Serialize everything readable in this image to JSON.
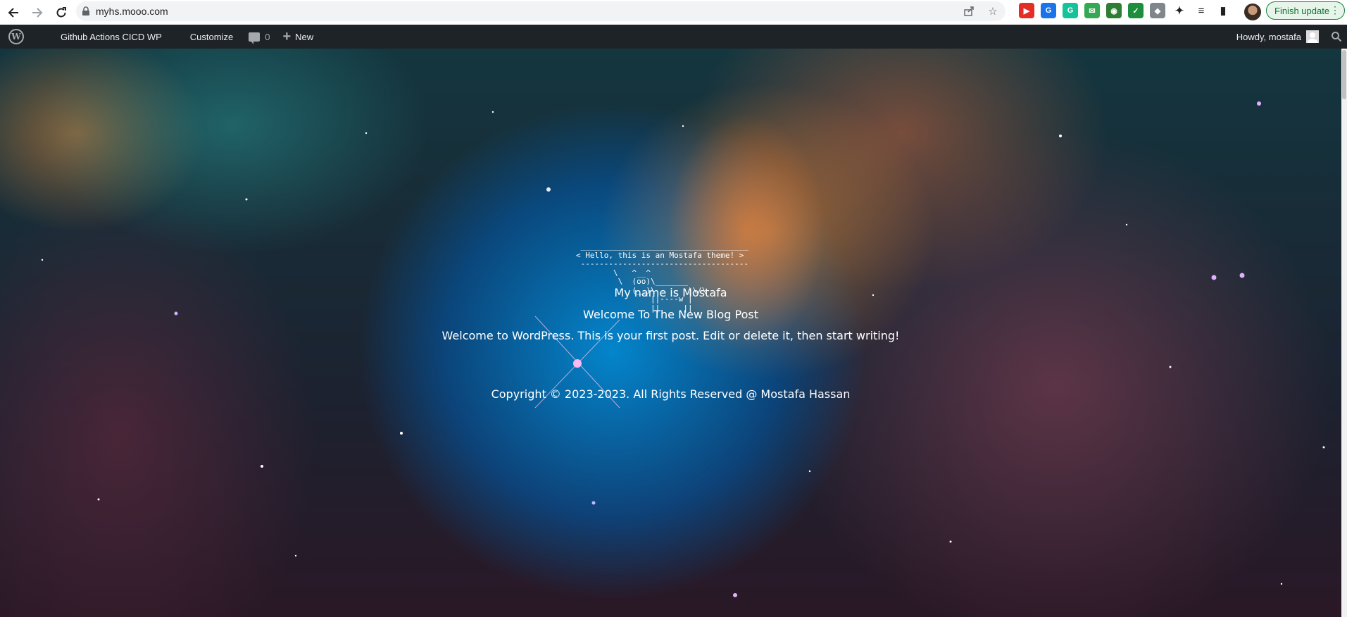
{
  "browser": {
    "url": "myhs.mooo.com",
    "finish_update_label": "Finish update",
    "omnibox_icons": [
      "share-icon",
      "star-icon"
    ],
    "extensions": [
      {
        "name": "youtube-extension-icon",
        "glyph": "▶",
        "color": "#e52d27"
      },
      {
        "name": "translate-extension-icon",
        "glyph": "G",
        "color": "#1a73e8"
      },
      {
        "name": "grammarly-extension-icon",
        "glyph": "G",
        "color": "#15c39a"
      },
      {
        "name": "inbox-extension-icon",
        "glyph": "✉",
        "color": "#34a853"
      },
      {
        "name": "globe-extension-icon",
        "glyph": "◉",
        "color": "#2e7d32"
      },
      {
        "name": "shield-check-extension-icon",
        "glyph": "✓",
        "color": "#1e8e3e"
      },
      {
        "name": "shield-extension-icon",
        "glyph": "◆",
        "color": "#80868b"
      },
      {
        "name": "puzzle-extensions-icon",
        "glyph": "✦",
        "color": "#202124"
      },
      {
        "name": "media-controls-icon",
        "glyph": "≡",
        "color": "#202124"
      },
      {
        "name": "side-panel-icon",
        "glyph": "▮",
        "color": "#202124"
      }
    ]
  },
  "adminbar": {
    "site_name": "Github Actions CICD WP",
    "customize": "Customize",
    "comments_count": "0",
    "new_label": "New",
    "howdy": "Howdy, mostafa"
  },
  "page": {
    "ascii_art": " ____________________________________\n< Hello, this is an Mostafa theme! >\n ------------------------------------\n        \\   ^__^\n         \\  (oo)\\_______\n            (__)\\       )\\/\\\n                ||----w |\n                ||     ||",
    "name_line": "My name is Mostafa",
    "post_title": "Welcome To The New Blog Post",
    "post_excerpt": "Welcome to WordPress. This is your first post. Edit or delete it, then start writing!",
    "copyright": "Copyright © 2023-2023. All Rights Reserved @ Mostafa Hassan"
  },
  "colors": {
    "adminbar_bg": "#1d2327",
    "finish_update_green": "#137333"
  }
}
